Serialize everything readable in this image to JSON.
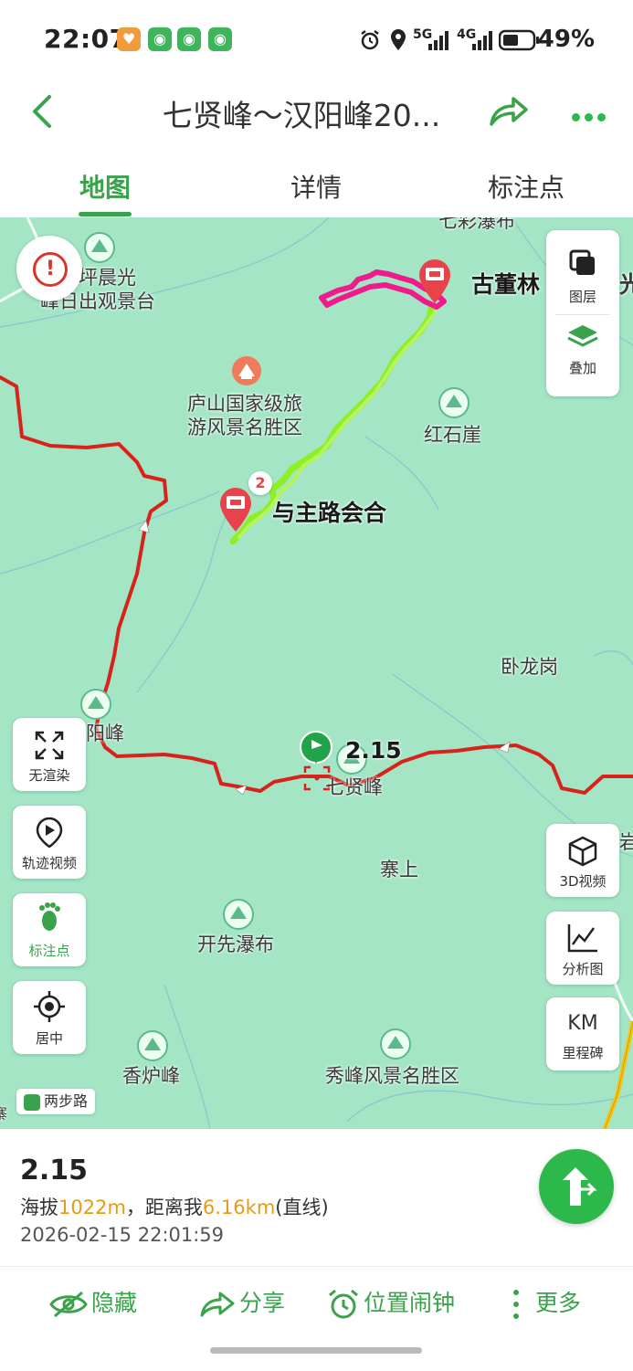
{
  "status_bar": {
    "time": "22:07",
    "network_5g": "5G",
    "network_4g": "4G",
    "battery_percent": "49%",
    "icons": [
      "heart-app-icon",
      "green-app-icon",
      "green-app-icon",
      "green-app-icon",
      "alarm-icon",
      "location-icon",
      "signal-icon",
      "signal-icon",
      "battery-icon"
    ]
  },
  "header": {
    "title": "七贤峰～汉阳峰20...",
    "back_icon": "chevron-left-icon",
    "share_icon": "share-icon",
    "more_icon": "more-dots-icon"
  },
  "tabs": [
    {
      "label": "地图",
      "active": true
    },
    {
      "label": "详情",
      "active": false
    },
    {
      "label": "标注点",
      "active": false
    }
  ],
  "map": {
    "labels": {
      "tianping": "仰天坪晨光",
      "richu": "峰日出观景台",
      "qicai": "七彩瀑布",
      "gudonglin": "古董林",
      "guang": "光",
      "lushan_1": "庐山国家级旅",
      "lushan_2": "游风景名胜区",
      "hongshiya": "红石崖",
      "marker_badge": "2",
      "yuzhulu": "与主路会合",
      "wolonggang": "卧龙岗",
      "yangfeng": "阳峰",
      "point_value": "2.15",
      "qixianfeng": "七贤峰",
      "zhaishang": "寨上",
      "kaixian": "开先瀑布",
      "xianglufeng": "香炉峰",
      "xiufeng": "秀峰风景名胜区",
      "edge_right": "岩",
      "edge_left": "寨"
    },
    "buttons": {
      "layers": "图层",
      "overlay": "叠加",
      "no_render": "无渲染",
      "track_video": "轨迹视频",
      "annotations": "标注点",
      "center": "居中",
      "video_3d": "3D视频",
      "analysis": "分析图",
      "km_main": "KM",
      "milestones": "里程碑"
    },
    "brand": "两步路",
    "colors": {
      "map_bg": "#a3e5c5",
      "main_road": "#d8231c",
      "track_green": "#8cf024",
      "track_pink": "#ef1a8c",
      "accent": "#3aa24b"
    }
  },
  "info_panel": {
    "title": "2.15",
    "altitude_prefix": "海拔",
    "altitude_value": "1022m",
    "distance_prefix": "，距离我",
    "distance_value": "6.16km",
    "distance_suffix": "(直线)",
    "timestamp": "2026-02-15 22:01:59"
  },
  "bottom_actions": {
    "hide": "隐藏",
    "share": "分享",
    "alarm": "位置闹钟",
    "more": "更多"
  }
}
